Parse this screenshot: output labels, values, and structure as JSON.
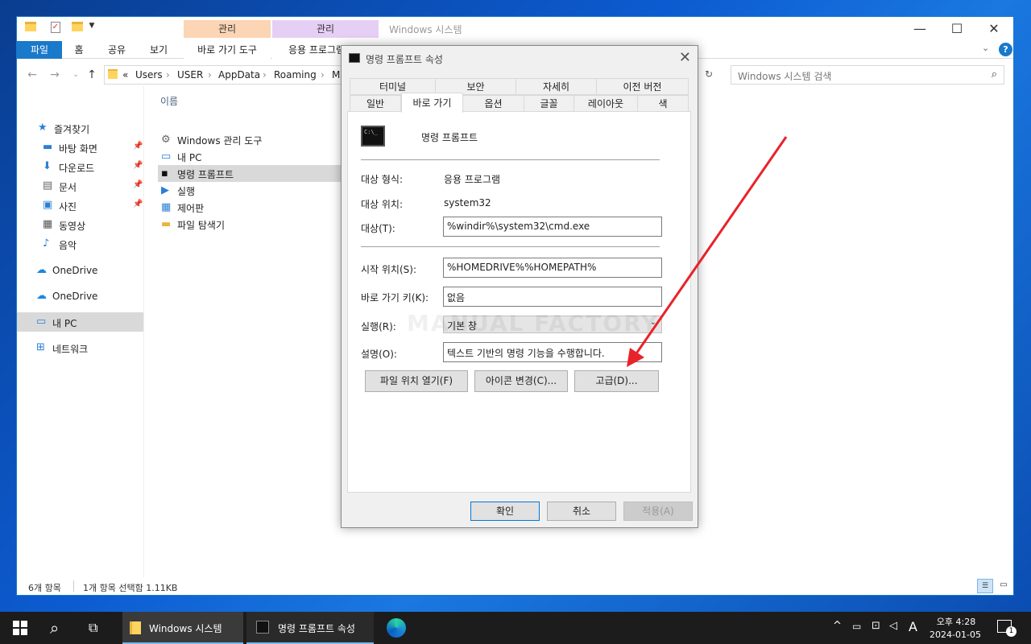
{
  "explorer": {
    "title": "Windows 시스템",
    "context_tabs": [
      {
        "group": "관리",
        "sub": "바로 가기 도구"
      },
      {
        "group": "관리",
        "sub": "응용 프로그램"
      }
    ],
    "ribbon_tabs": [
      "파일",
      "홈",
      "공유",
      "보기"
    ],
    "breadcrumb": [
      "«",
      "Users",
      "USER",
      "AppData",
      "Roaming",
      "Mi"
    ],
    "search_placeholder": "Windows 시스템 검색",
    "nav": [
      {
        "label": "즐겨찾기",
        "icon": "star-icon"
      },
      {
        "label": "바탕 화면",
        "icon": "desktop-icon",
        "pinned": true
      },
      {
        "label": "다운로드",
        "icon": "download-icon",
        "pinned": true
      },
      {
        "label": "문서",
        "icon": "document-icon",
        "pinned": true
      },
      {
        "label": "사진",
        "icon": "picture-icon",
        "pinned": true
      },
      {
        "label": "동영상",
        "icon": "video-icon"
      },
      {
        "label": "음악",
        "icon": "music-icon"
      },
      {
        "label": "OneDrive",
        "icon": "cloud-icon"
      },
      {
        "label": "OneDrive",
        "icon": "cloud-icon"
      },
      {
        "label": "내 PC",
        "icon": "pc-icon",
        "selected": true
      },
      {
        "label": "네트워크",
        "icon": "network-icon"
      }
    ],
    "column_header": "이름",
    "files": [
      {
        "label": "Windows 관리 도구",
        "icon": "admin-tools-icon"
      },
      {
        "label": "내 PC",
        "icon": "pc-icon"
      },
      {
        "label": "명령 프롬프트",
        "icon": "cmd-icon",
        "selected": true
      },
      {
        "label": "실행",
        "icon": "run-icon"
      },
      {
        "label": "제어판",
        "icon": "control-panel-icon"
      },
      {
        "label": "파일 탐색기",
        "icon": "folder-icon"
      }
    ],
    "status_count": "6개 항목",
    "status_selected": "1개 항목 선택함 1.11KB"
  },
  "dialog": {
    "title": "명령 프롬프트 속성",
    "tabs_row1": [
      "터미널",
      "보안",
      "자세히",
      "이전 버전"
    ],
    "tabs_row2": [
      "일반",
      "바로 가기",
      "옵션",
      "글꼴",
      "레이아웃",
      "색"
    ],
    "shortcut_name": "명령 프롬프트",
    "target_type_label": "대상 형식:",
    "target_type_value": "응용 프로그램",
    "target_location_label": "대상 위치:",
    "target_location_value": "system32",
    "target_label": "대상(T):",
    "target_value": "%windir%\\system32\\cmd.exe",
    "start_in_label": "시작 위치(S):",
    "start_in_value": "%HOMEDRIVE%%HOMEPATH%",
    "hotkey_label": "바로 가기 키(K):",
    "hotkey_value": "없음",
    "run_label": "실행(R):",
    "run_value": "기본 창",
    "comment_label": "설명(O):",
    "comment_value": "텍스트 기반의 명령 기능을 수행합니다.",
    "btn_open_location": "파일 위치 열기(F)",
    "btn_change_icon": "아이콘 변경(C)...",
    "btn_advanced": "고급(D)...",
    "btn_ok": "확인",
    "btn_cancel": "취소",
    "btn_apply": "적용(A)"
  },
  "watermark": "MANUAL FACTORY",
  "taskbar": {
    "items": [
      {
        "label": "Windows 시스템",
        "icon": "folder-icon"
      },
      {
        "label": "명령 프롬프트 속성",
        "icon": "cmd-icon"
      }
    ],
    "time": "오후 4:28",
    "date": "2024-01-05",
    "notification_count": "1"
  },
  "colors": {
    "accent": "#1979ca",
    "arrow": "#e8232a",
    "ctx_tab_1": "#fcd5b4",
    "ctx_tab_2": "#e6cff5"
  }
}
